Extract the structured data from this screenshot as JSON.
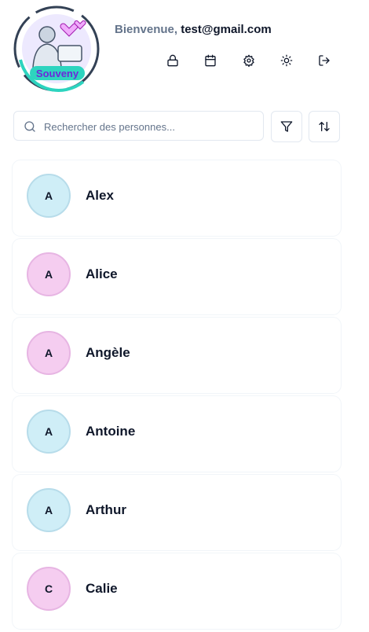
{
  "header": {
    "logo_text": "Souveny",
    "welcome_prefix": "Bienvenue,",
    "user_email": "test@gmail.com",
    "icons": [
      "lock-icon",
      "calendar-icon",
      "settings-icon",
      "sun-icon",
      "logout-icon"
    ]
  },
  "search": {
    "placeholder": "Rechercher des personnes...",
    "value": ""
  },
  "toolbar": {
    "filter_icon": "filter-icon",
    "sort_icon": "sort-icon"
  },
  "people": [
    {
      "initial": "A",
      "name": "Alex",
      "color": "blue"
    },
    {
      "initial": "A",
      "name": "Alice",
      "color": "pink"
    },
    {
      "initial": "A",
      "name": "Angèle",
      "color": "pink"
    },
    {
      "initial": "A",
      "name": "Antoine",
      "color": "blue"
    },
    {
      "initial": "A",
      "name": "Arthur",
      "color": "blue"
    },
    {
      "initial": "C",
      "name": "Calie",
      "color": "pink"
    }
  ],
  "colors": {
    "avatar_blue": "#cfeef7",
    "avatar_pink": "#f5cdf0",
    "accent_teal": "#2dd4bf",
    "accent_purple": "#8b5cf6"
  }
}
